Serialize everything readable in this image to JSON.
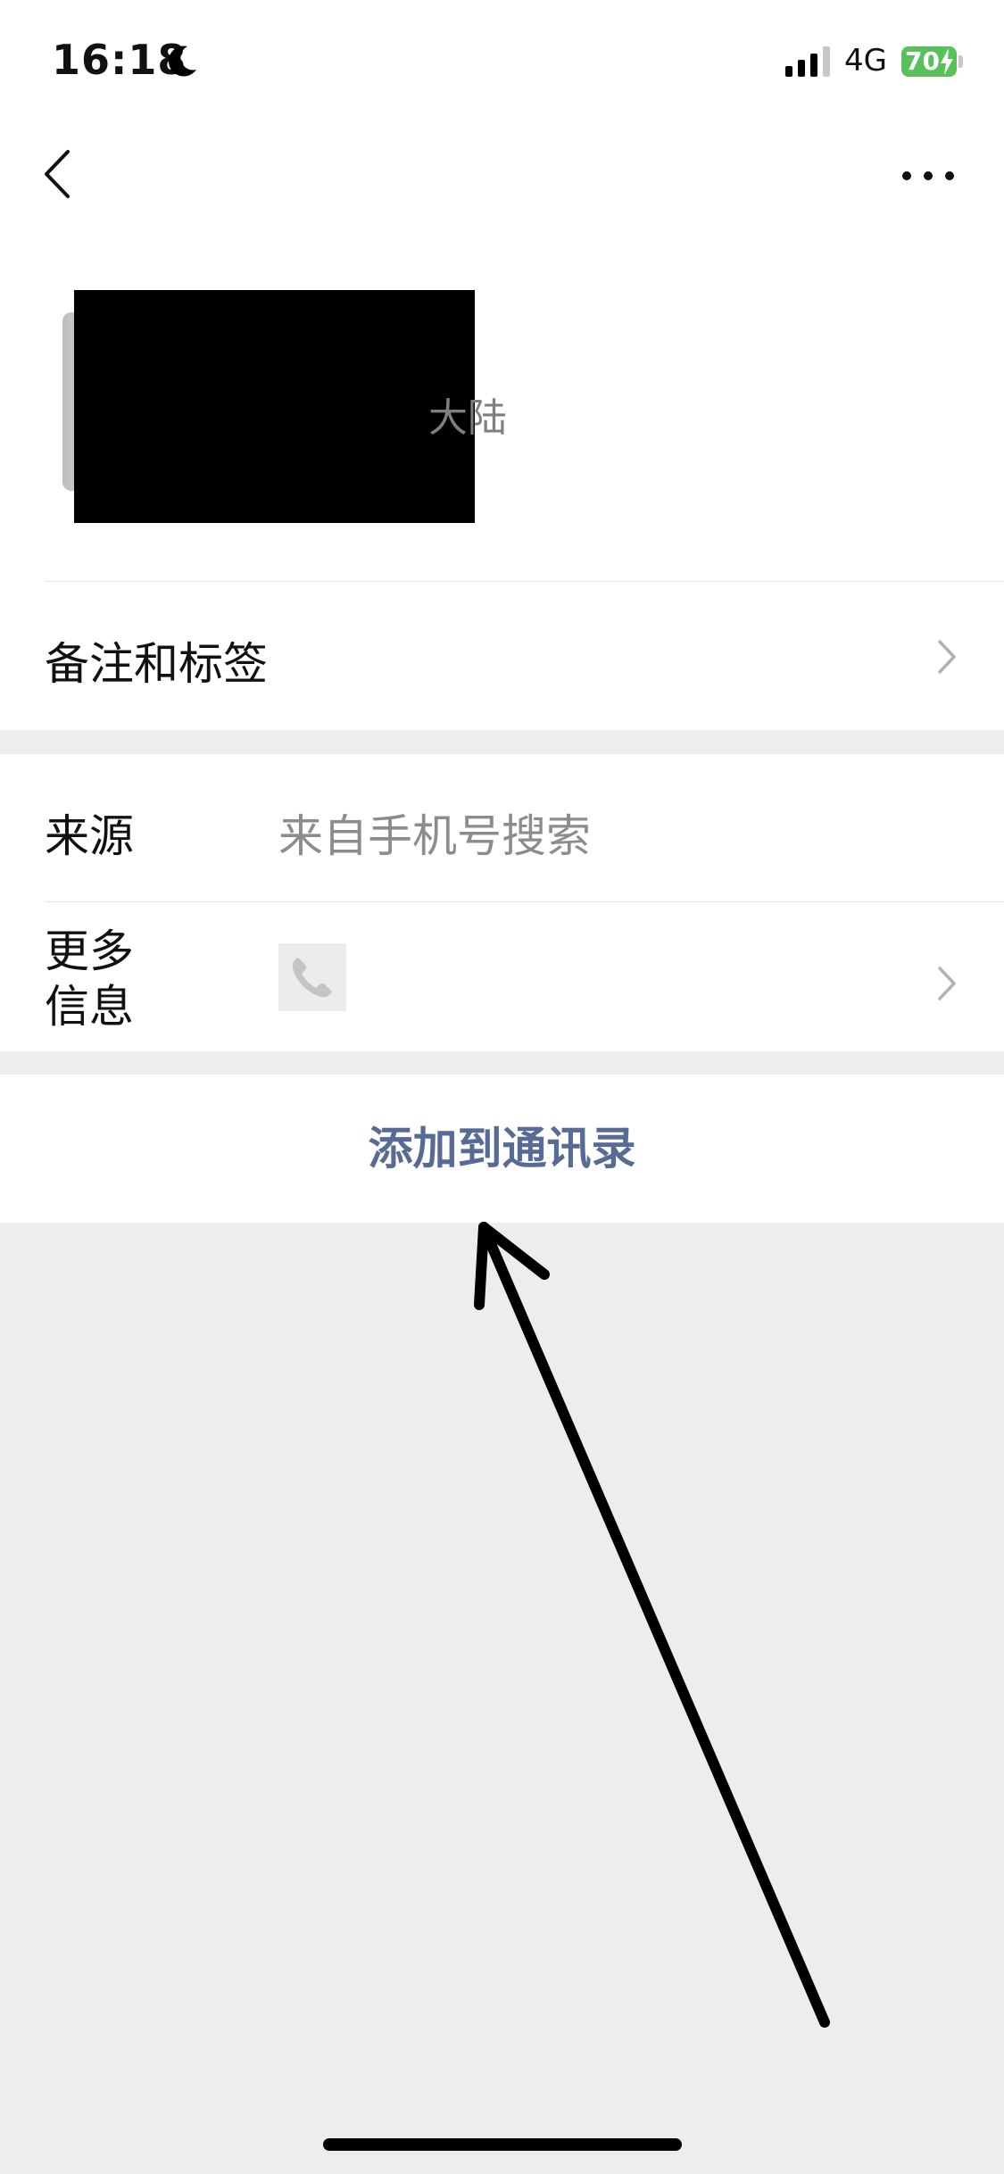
{
  "status_bar": {
    "time": "16:18",
    "network": "4G",
    "battery_level": "70",
    "icons": [
      "moon-icon",
      "signal-icon",
      "battery-charging-icon"
    ]
  },
  "nav": {
    "back_icon": "chevron-left-icon",
    "more_icon": "ellipsis-icon"
  },
  "profile": {
    "region_visible_text": "大陆"
  },
  "remark_row": {
    "label": "备注和标签"
  },
  "info": {
    "source_label": "来源",
    "source_value": "来自手机号搜索",
    "more_info_label": "更多\n信息",
    "more_info_icon": "phone-icon"
  },
  "actions": {
    "add_to_contacts": "添加到通讯录"
  },
  "colors": {
    "link_blue": "#576b95",
    "background_gray": "#ededed",
    "battery_green": "#59c15a"
  }
}
